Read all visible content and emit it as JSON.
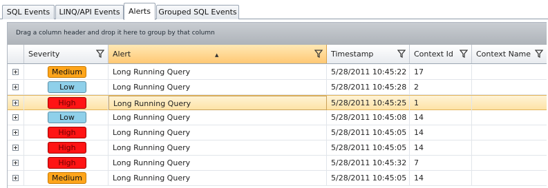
{
  "tabs": [
    {
      "label": "SQL Events",
      "active": false
    },
    {
      "label": "LINQ/API Events",
      "active": false
    },
    {
      "label": "Alerts",
      "active": true
    },
    {
      "label": "Grouped SQL Events",
      "active": false
    }
  ],
  "group_panel_text": "Drag a column header and drop it here to group by that column",
  "columns": [
    {
      "label": "Severity",
      "sorted": false
    },
    {
      "label": "Alert",
      "sorted": true
    },
    {
      "label": "Timestamp",
      "sorted": false
    },
    {
      "label": "Context Id",
      "sorted": false
    },
    {
      "label": "Context Name",
      "sorted": false
    }
  ],
  "rows": [
    {
      "severity": "Medium",
      "alert": "Long Running Query",
      "timestamp": "5/28/2011 10:45:22 A",
      "context_id": "17",
      "context_name": "",
      "selected": false
    },
    {
      "severity": "Low",
      "alert": "Long Running Query",
      "timestamp": "5/28/2011 10:45:28 A",
      "context_id": "2",
      "context_name": "",
      "selected": false
    },
    {
      "severity": "High",
      "alert": "Long Running Query",
      "timestamp": "5/28/2011 10:45:25 A",
      "context_id": "1",
      "context_name": "",
      "selected": true
    },
    {
      "severity": "Low",
      "alert": "Long Running Query",
      "timestamp": "5/28/2011 10:45:08 A",
      "context_id": "14",
      "context_name": "",
      "selected": false
    },
    {
      "severity": "High",
      "alert": "Long Running Query",
      "timestamp": "5/28/2011 10:45:05 A",
      "context_id": "14",
      "context_name": "",
      "selected": false
    },
    {
      "severity": "High",
      "alert": "Long Running Query",
      "timestamp": "5/28/2011 10:45:05 A",
      "context_id": "14",
      "context_name": "",
      "selected": false
    },
    {
      "severity": "High",
      "alert": "Long Running Query",
      "timestamp": "5/28/2011 10:45:32 A",
      "context_id": "7",
      "context_name": "",
      "selected": false
    },
    {
      "severity": "Medium",
      "alert": "Long Running Query",
      "timestamp": "5/28/2011 10:45:05 A",
      "context_id": "14",
      "context_name": "",
      "selected": false
    }
  ],
  "severity_colors": {
    "Medium": "#ffa51b",
    "Low": "#8fd0ea",
    "High": "#ff1414"
  },
  "accent_color": "#ffc874"
}
